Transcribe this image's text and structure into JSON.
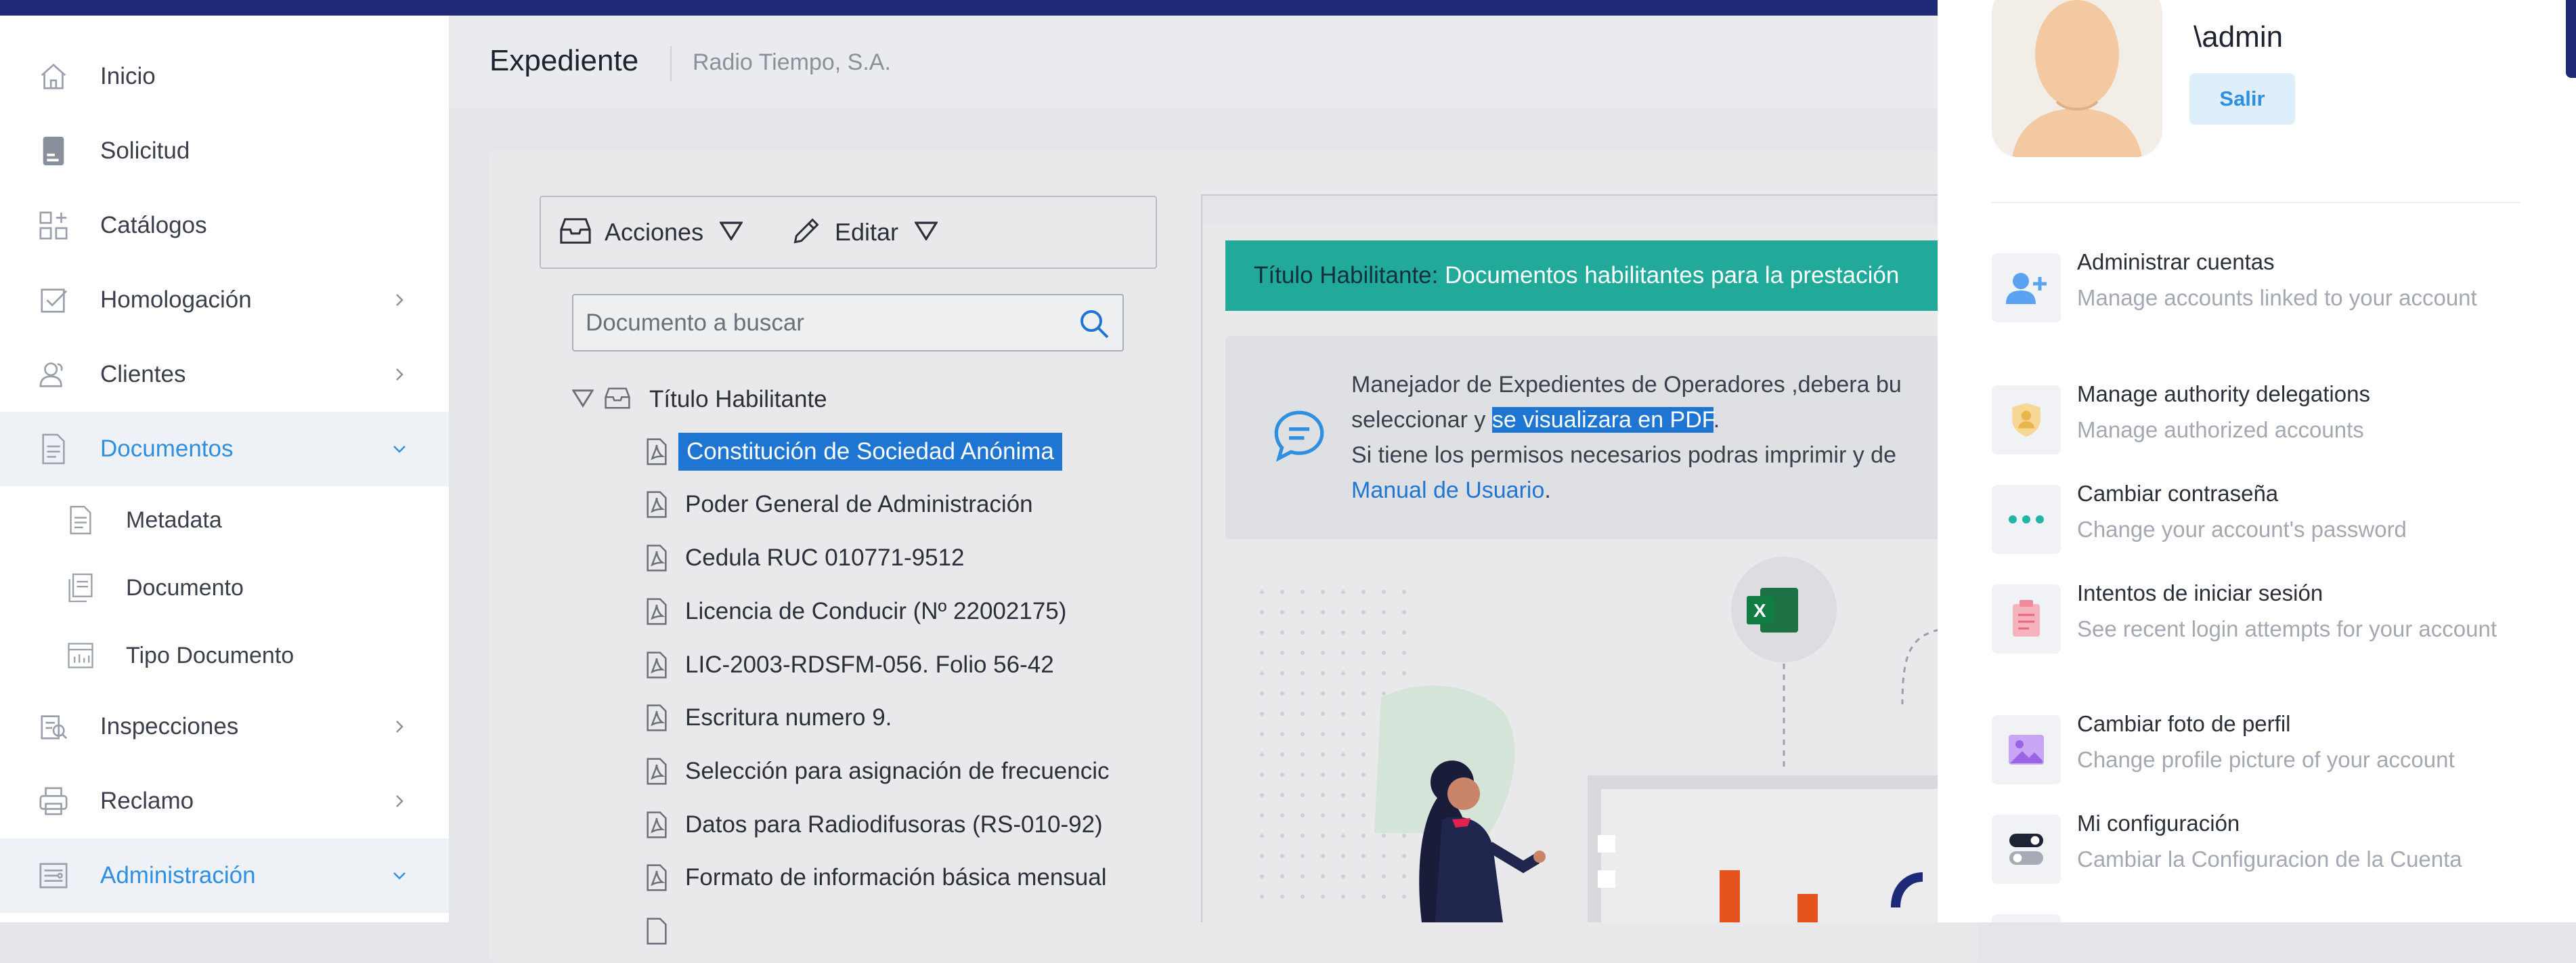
{
  "sidebar": {
    "items": [
      {
        "label": "Inicio",
        "icon": "home-icon"
      },
      {
        "label": "Solicitud",
        "icon": "document-icon"
      },
      {
        "label": "Catálogos",
        "icon": "grid-add-icon"
      },
      {
        "label": "Homologación",
        "icon": "checkbox-icon"
      },
      {
        "label": "Clientes",
        "icon": "users-icon"
      },
      {
        "label": "Documentos",
        "icon": "file-text-icon",
        "active": true
      },
      {
        "label": "Inspecciones",
        "icon": "inspection-icon"
      },
      {
        "label": "Reclamo",
        "icon": "printer-icon"
      },
      {
        "label": "Administración",
        "icon": "admin-icon",
        "active": true
      }
    ],
    "sub_items": [
      {
        "label": "Metadata"
      },
      {
        "label": "Documento"
      },
      {
        "label": "Tipo Documento"
      }
    ]
  },
  "header": {
    "title": "Expediente",
    "subtitle": "Radio Tiempo, S.A."
  },
  "toolbar": {
    "actions_label": "Acciones",
    "edit_label": "Editar"
  },
  "search": {
    "placeholder": "Documento a buscar"
  },
  "tree": {
    "root_label": "Título Habilitante",
    "items": [
      "Constitución de Sociedad Anónima",
      "Poder General de Administración",
      "Cedula RUC 010771-9512",
      "Licencia de Conducir (Nº 22002175)",
      "LIC-2003-RDSFM-056. Folio 56-42",
      "Escritura numero 9.",
      "Selección para asignación de frecuencic",
      "Datos para Radiodifusoras (RS-010-92)",
      "Formato de información básica mensual"
    ]
  },
  "banner": {
    "label": "Título Habilitante:",
    "text": "Documentos habilitantes para la prestación"
  },
  "info": {
    "line1": "Manejador de Expedientes de Operadores ,debera bu",
    "line2_pre": "seleccionar y ",
    "line2_highlight": "se visualizara en PDF",
    "line2_post": ".",
    "line3": "Si tiene los permisos necesarios podras imprimir y de",
    "link": "Manual de Usuario",
    "link_post": "."
  },
  "user_menu": {
    "username": "\\admin",
    "logout_label": "Salir",
    "items": [
      {
        "title": "Administrar cuentas",
        "desc": "Manage accounts linked to your account",
        "icon": "add-user-icon"
      },
      {
        "title": "Manage authority delegations",
        "desc": "Manage authorized accounts",
        "icon": "badge-icon"
      },
      {
        "title": "Cambiar contraseña",
        "desc": "Change your account's password",
        "icon": "dots-icon"
      },
      {
        "title": "Intentos de iniciar sesión",
        "desc": "See recent login attempts for your account",
        "icon": "clipboard-icon"
      },
      {
        "title": "Cambiar foto de perfil",
        "desc": "Change profile picture of your account",
        "icon": "image-icon"
      },
      {
        "title": "Mi configuración",
        "desc": "Cambiar la Configuracion de la Cuenta",
        "icon": "toggle-icon"
      }
    ]
  },
  "colors": {
    "brand_dark": "#1e2a78",
    "accent_blue": "#2f8fe0",
    "banner_teal": "#21a99a",
    "selection_blue": "#1f76d2"
  }
}
